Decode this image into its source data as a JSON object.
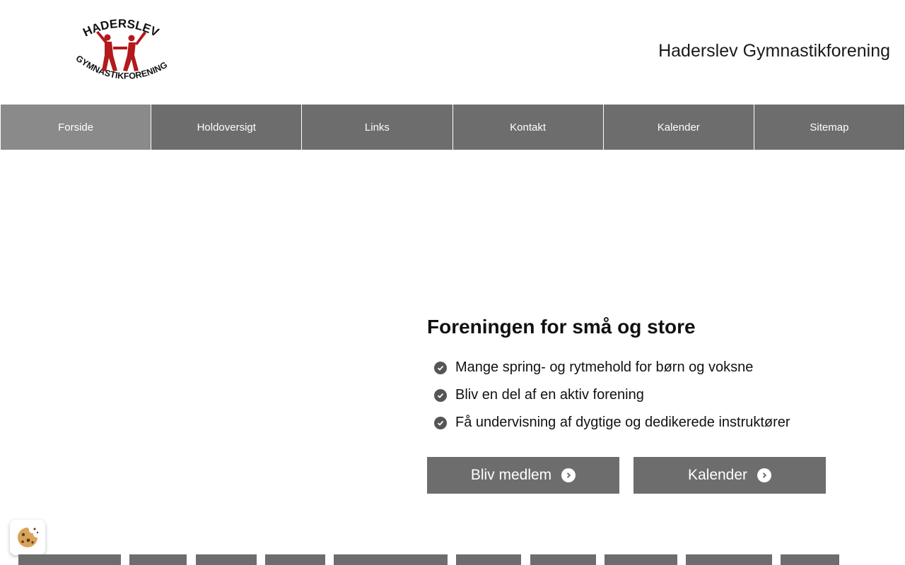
{
  "header": {
    "site_title": "Haderslev Gymnastikforening",
    "logo_text_top": "HADERSLEV",
    "logo_text_bottom": "GYMNASTIKFORENING"
  },
  "nav": {
    "items": [
      {
        "label": "Forside",
        "active": true
      },
      {
        "label": "Holdoversigt",
        "active": false
      },
      {
        "label": "Links",
        "active": false
      },
      {
        "label": "Kontakt",
        "active": false
      },
      {
        "label": "Kalender",
        "active": false
      },
      {
        "label": "Sitemap",
        "active": false
      }
    ]
  },
  "hero": {
    "heading": "Foreningen for små og store",
    "benefits": [
      "Mange spring- og rytmehold for børn og voksne",
      "Bliv en del af en aktiv forening",
      "Få undervisning af dygtige og dedikerede instruktører"
    ],
    "buttons": {
      "join_label": "Bliv medlem",
      "calendar_label": "Kalender"
    }
  },
  "colors": {
    "nav_bg": "#6d6d6d",
    "nav_active_bg": "#8a8a8a",
    "logo_red": "#b3191d",
    "button_bg": "#6d6d6d"
  },
  "icons": {
    "benefit": "check-circle-icon",
    "button_arrow": "chevron-circle-right-icon",
    "cookie": "cookie-icon"
  }
}
